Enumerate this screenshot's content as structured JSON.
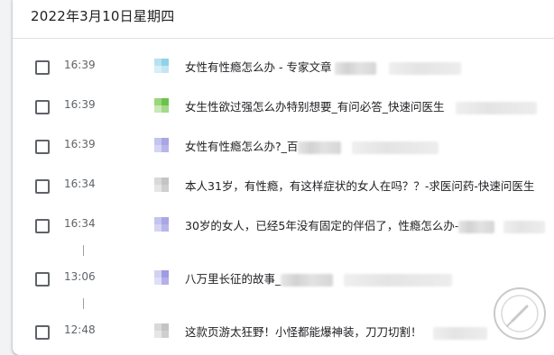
{
  "history": {
    "date_header": "2022年3月10日星期四",
    "entries": [
      {
        "time": "16:39",
        "title": "女性有性瘾怎么办 - 专家文章",
        "favicon_colors": [
          "#b6e3f0",
          "#8fd3ea",
          "#d7eff7",
          "#c4e6f2"
        ],
        "favicon_icon": "site-favicon"
      },
      {
        "time": "16:39",
        "title": "女生性欲过强怎么办特别想要_有问必答_快速问医生",
        "favicon_colors": [
          "#9ad67c",
          "#6cc24a",
          "#c9e9b8",
          "#a3d98a"
        ],
        "favicon_icon": "site-favicon"
      },
      {
        "time": "16:39",
        "title": "女性有性瘾怎么办?_百",
        "favicon_colors": [
          "#c5c3ef",
          "#a9a5e6",
          "#d6d4f4",
          "#b8b5ea"
        ],
        "favicon_icon": "site-favicon"
      },
      {
        "time": "16:34",
        "title": "本人31岁，有性瘾，有这样症状的女人在吗？？-求医问药-快速问医生",
        "favicon_colors": [
          "#d9d9d9",
          "#c4c4c4",
          "#e6e6e6",
          "#cfcfcf"
        ],
        "favicon_icon": "site-favicon"
      },
      {
        "time": "16:34",
        "title": "30岁的女人，已经5年没有固定的伴侣了，性瘾怎么办-",
        "favicon_colors": [
          "#c5c3ef",
          "#a9a5e6",
          "#d6d4f4",
          "#b8b5ea"
        ],
        "favicon_icon": "site-favicon"
      },
      {
        "time": "13:06",
        "title": "八万里长征的故事_",
        "favicon_colors": [
          "#d3d1f2",
          "#9f9be4",
          "#e0dff6",
          "#b3b0ea"
        ],
        "favicon_icon": "site-favicon"
      },
      {
        "time": "12:48",
        "title": "这款页游太狂野！小怪都能爆神装，刀刀切割！",
        "favicon_colors": [
          "#d9d9d9",
          "#c4c4c4",
          "#e6e6e6",
          "#cfcfcf"
        ],
        "favicon_icon": "site-favicon"
      }
    ]
  },
  "colors": {
    "background": "#f1f3f4",
    "card": "#ffffff",
    "text_primary": "#202124",
    "text_secondary": "#5f6368"
  }
}
